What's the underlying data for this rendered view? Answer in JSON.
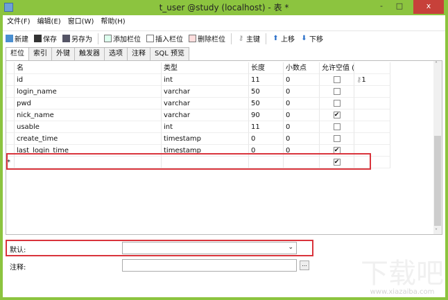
{
  "window": {
    "title": "t_user @study (localhost) - 表 *",
    "minimize": "-",
    "maximize": "□",
    "close": "x"
  },
  "menu": [
    "文件(F)",
    "编辑(E)",
    "窗口(W)",
    "帮助(H)"
  ],
  "toolbar": {
    "new": "新建",
    "save": "保存",
    "save_as": "另存为",
    "add_field": "添加栏位",
    "insert_field": "插入栏位",
    "delete_field": "删除栏位",
    "primary_key": "主键",
    "move_up": "上移",
    "move_down": "下移"
  },
  "tabs": [
    "栏位",
    "索引",
    "外键",
    "触发器",
    "选项",
    "注释",
    "SQL 预览"
  ],
  "grid": {
    "headers": [
      "名",
      "类型",
      "长度",
      "小数点",
      "允许空值 (",
      ""
    ],
    "rows": [
      {
        "name": "id",
        "type": "int",
        "length": "11",
        "decimals": "0",
        "nullable": false,
        "key": "1"
      },
      {
        "name": "login_name",
        "type": "varchar",
        "length": "50",
        "decimals": "0",
        "nullable": false,
        "key": ""
      },
      {
        "name": "pwd",
        "type": "varchar",
        "length": "50",
        "decimals": "0",
        "nullable": false,
        "key": ""
      },
      {
        "name": "nick_name",
        "type": "varchar",
        "length": "90",
        "decimals": "0",
        "nullable": true,
        "key": ""
      },
      {
        "name": "usable",
        "type": "int",
        "length": "11",
        "decimals": "0",
        "nullable": false,
        "key": ""
      },
      {
        "name": "create_time",
        "type": "timestamp",
        "length": "0",
        "decimals": "0",
        "nullable": false,
        "key": ""
      },
      {
        "name": "last_login_time",
        "type": "timestamp",
        "length": "0",
        "decimals": "0",
        "nullable": true,
        "key": ""
      }
    ],
    "new_row": {
      "marker": "*",
      "nullable": true
    }
  },
  "props": {
    "default_label": "默认:",
    "default_value": "",
    "comment_label": "注释:",
    "comment_value": "",
    "ellipsis": "..."
  },
  "watermark": {
    "text": "下载吧",
    "url": "www.xiazaiba.com"
  },
  "colors": {
    "frame": "#8cc43f",
    "highlight": "#d9333b"
  }
}
